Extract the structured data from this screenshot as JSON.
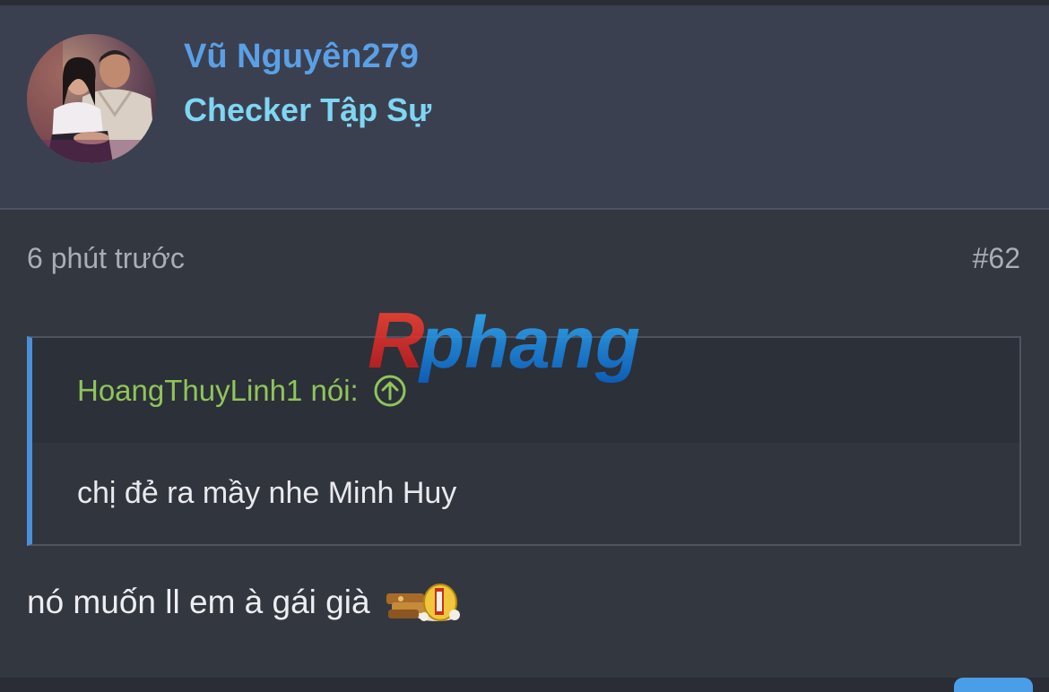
{
  "user": {
    "name": "Vũ Nguyên279",
    "title": "Checker Tập Sự"
  },
  "post": {
    "time": "6 phút trước",
    "number": "#62"
  },
  "quote": {
    "author_label": "HoangThuyLinh1 nói:",
    "content": "chị đẻ ra mầy nhe Minh Huy"
  },
  "reply": {
    "text": "nó muốn ll em à gái già"
  },
  "watermark": {
    "text": "Rphang"
  },
  "colors": {
    "username": "#5aa0e6",
    "user_title": "#7fd6f2",
    "quote_author": "#8fc55a",
    "quote_bar": "#4a90d9"
  },
  "icons": {
    "quote_link": "arrow-up-circle-icon",
    "emoticon": "money-emoticon"
  }
}
